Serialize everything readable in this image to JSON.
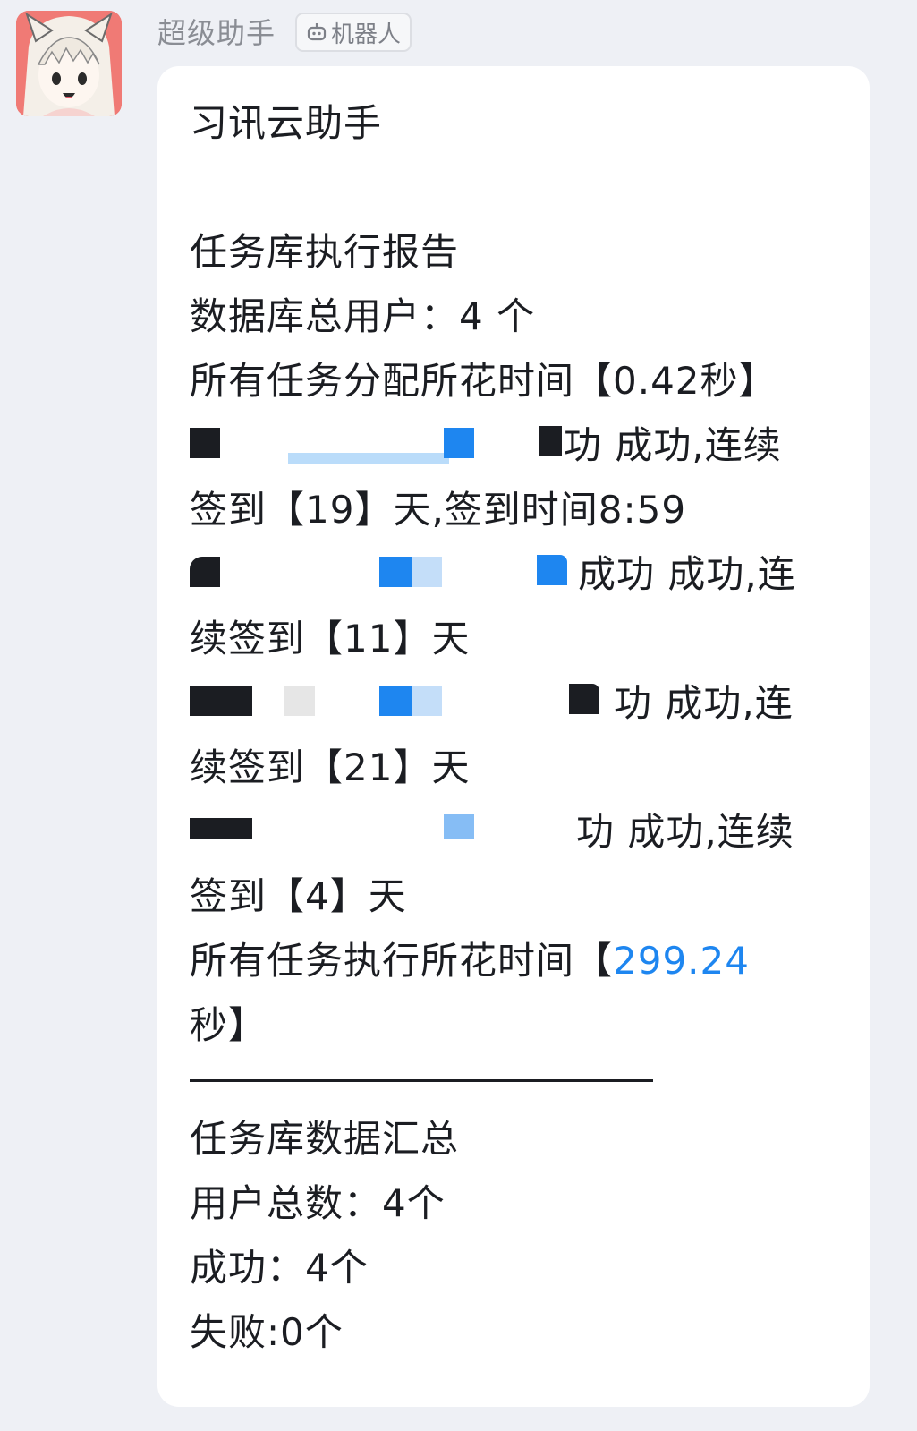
{
  "sender": {
    "name": "超级助手",
    "badge_label": "机器人",
    "badge_icon": "robot-icon",
    "avatar_icon": "anime-catgirl-avatar"
  },
  "message": {
    "title": "习讯云助手",
    "report_title": "任务库执行报告",
    "db_users": "数据库总用户：4 个",
    "assign_time": "所有任务分配所花时间【0.42秒】",
    "entries": [
      {
        "line1_tail": "功 成功,连续",
        "line2": "签到【19】天,签到时间8:59"
      },
      {
        "line1_tail": "成功 成功,连",
        "line2": "续签到【11】天"
      },
      {
        "line1_tail": "功 成功,连",
        "line2": "续签到【21】天"
      },
      {
        "line1_tail": "功 成功,连续",
        "line2": "签到【4】天"
      }
    ],
    "exec_time_prefix": "所有任务执行所花时间【",
    "exec_time_value": "299.24",
    "exec_time_suffix": "秒】",
    "summary_title": "任务库数据汇总",
    "total_users": "用户总数：4个",
    "success": "成功：4个",
    "failure": "失败:0个"
  },
  "colors": {
    "accent": "#1e86f0",
    "background": "#eef0f5",
    "bubble": "#ffffff"
  }
}
